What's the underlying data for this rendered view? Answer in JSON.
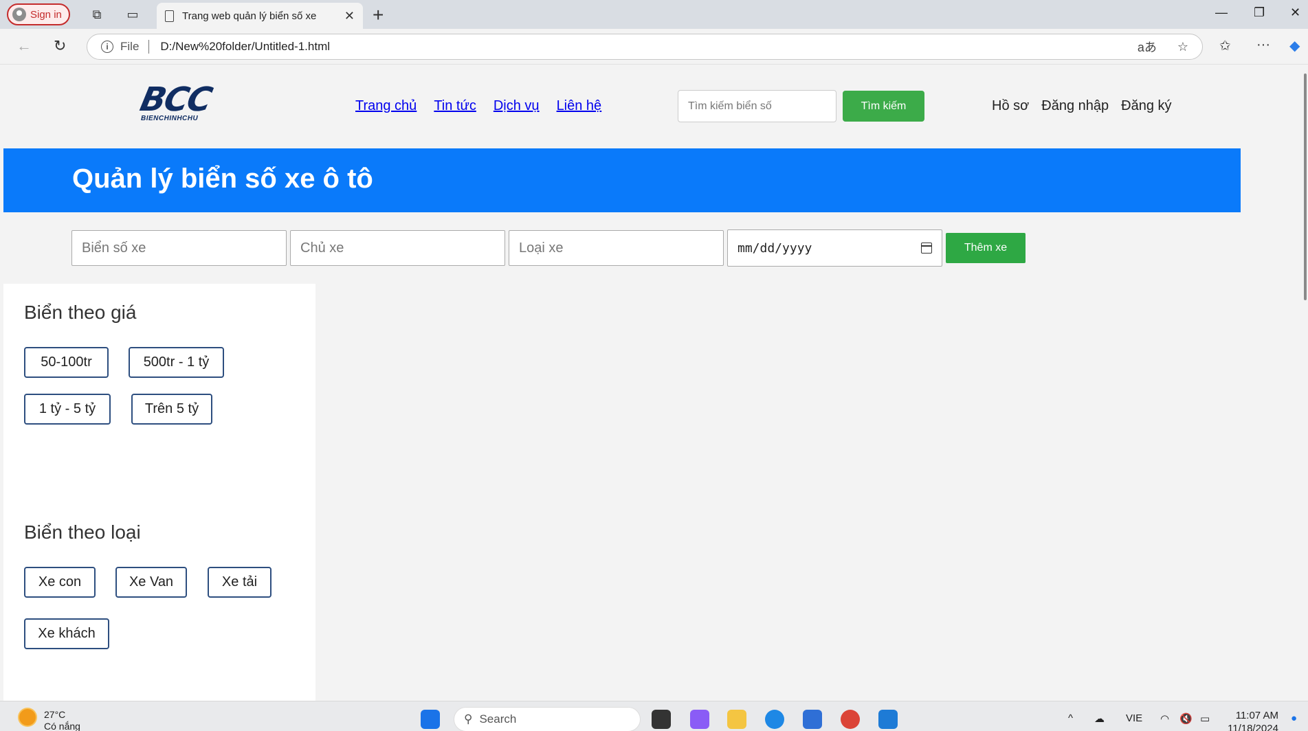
{
  "browser": {
    "signin_label": "Sign in",
    "tab_title": "Trang web quản lý biển số xe",
    "address_scheme": "File",
    "address_url": "D:/New%20folder/Untitled-1.html",
    "read_aloud_glyph": "aあ"
  },
  "site": {
    "logo_mark": "BCC",
    "logo_sub": "BIENCHINHCHU",
    "nav": [
      "Trang chủ",
      "Tin tức",
      "Dịch vụ",
      "Liên hệ"
    ],
    "search_placeholder": "Tìm kiếm biển số",
    "search_button": "Tìm kiếm",
    "user_nav": [
      "Hồ sơ",
      "Đăng nhập",
      "Đăng ký"
    ]
  },
  "banner": {
    "title": "Quản lý biển số xe ô tô"
  },
  "add_form": {
    "plate_placeholder": "Biển số xe",
    "owner_placeholder": "Chủ xe",
    "type_placeholder": "Loại xe",
    "date_placeholder": "mm/dd/yyyy",
    "submit_label": "Thêm xe"
  },
  "sidebar": {
    "price_heading": "Biển theo giá",
    "price_filters": [
      "50-100tr",
      "500tr - 1 tỷ",
      "1 tỷ  - 5 tỷ",
      "Trên 5 tỷ"
    ],
    "type_heading": "Biển theo loại",
    "type_filters": [
      "Xe con",
      "Xe Van",
      "Xe tải",
      "Xe khách"
    ]
  },
  "taskbar": {
    "temperature": "27°C",
    "weather_text": "Có nắng",
    "search_label": "Search",
    "language": "VIE",
    "time": "11:07 AM",
    "date": "11/18/2024"
  },
  "colors": {
    "banner": "#0a7afa",
    "green_button": "#3cab49",
    "chip_border": "#2d4e7f",
    "logo": "#102d62"
  }
}
